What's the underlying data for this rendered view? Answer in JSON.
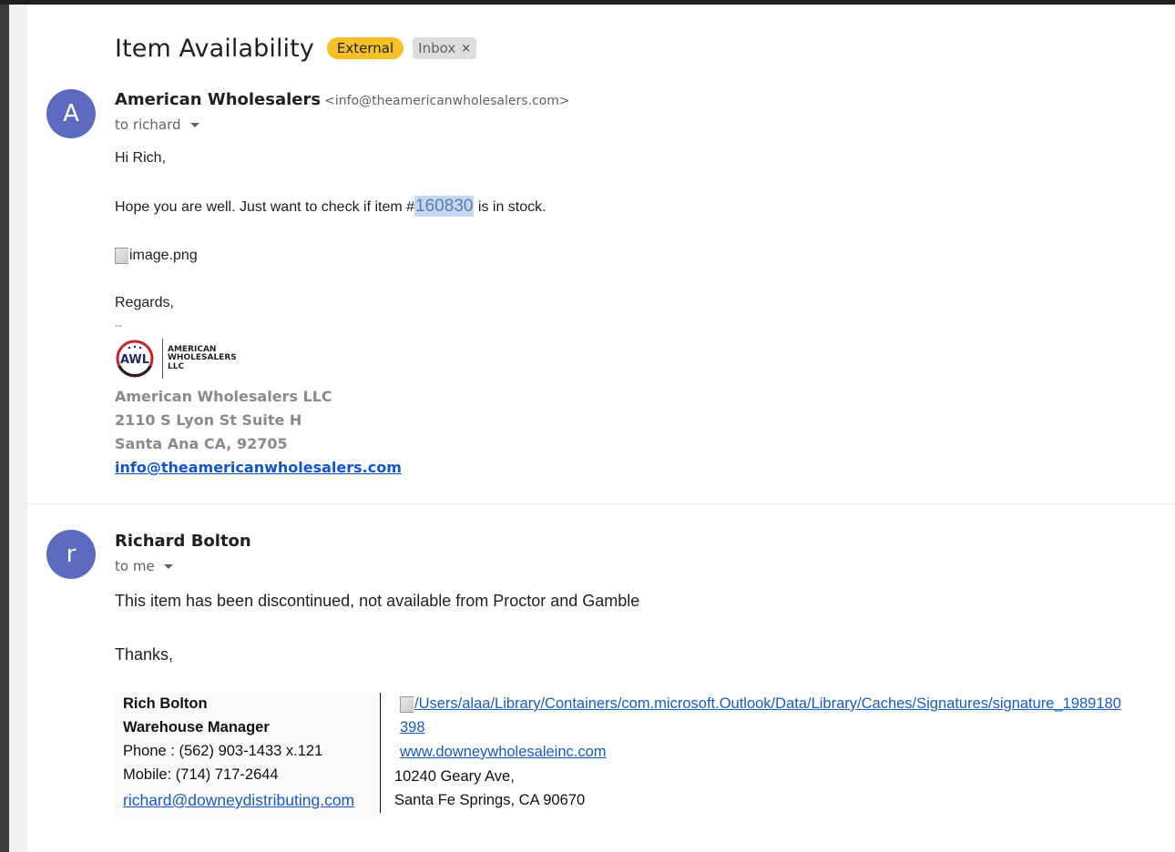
{
  "subject": {
    "title": "Item Availability",
    "tags": [
      {
        "label": "External"
      },
      {
        "label": "Inbox",
        "remove": "×"
      }
    ]
  },
  "message1": {
    "avatar_letter": "A",
    "sender_name": "American Wholesalers",
    "sender_email": "<info@theamericanwholesalers.com>",
    "recipient": "to richard",
    "greeting": "Hi Rich,",
    "body_before": "Hope you are well. Just want to check if item #",
    "body_highlight": "160830",
    "body_after": " is in stock.",
    "image_alt": "image.png",
    "regards": "Regards,",
    "sig_dash": "--",
    "logo_text": [
      "AMERICAN",
      "WHOLESALERS",
      "LLC"
    ],
    "company": "American Wholesalers LLC",
    "address1": "2110 S Lyon St Suite H",
    "address2": "Santa Ana CA, 92705",
    "email_link": "info@theamericanwholesalers.com"
  },
  "message2": {
    "avatar_letter": "r",
    "sender_name": "Richard Bolton",
    "recipient": "to me",
    "body": "This item has been discontinued, not available from Proctor and Gamble",
    "thanks": "Thanks,",
    "signature": {
      "name": "Rich Bolton",
      "title": "Warehouse Manager",
      "phone": "Phone : (562) 903-1433 x.121",
      "mobile": "Mobile: (714) 717-2644",
      "email": "richard@downeydistributing.com",
      "image_path_line1": "/Users/alaa/Library/Containers/com.microsoft.Outlook/Data/Library/Caches/Signatures/signature_1989180",
      "image_path_line2": "398",
      "website": "www.downeywholesaleinc.com",
      "street": "10240 Geary Ave,",
      "city": "Santa Fe Springs, CA 90670"
    }
  },
  "colors": {
    "external_tag": "#f6c026",
    "avatar": "#5c6bc0",
    "link": "#1155cc",
    "highlight": "#c3d8f0"
  }
}
